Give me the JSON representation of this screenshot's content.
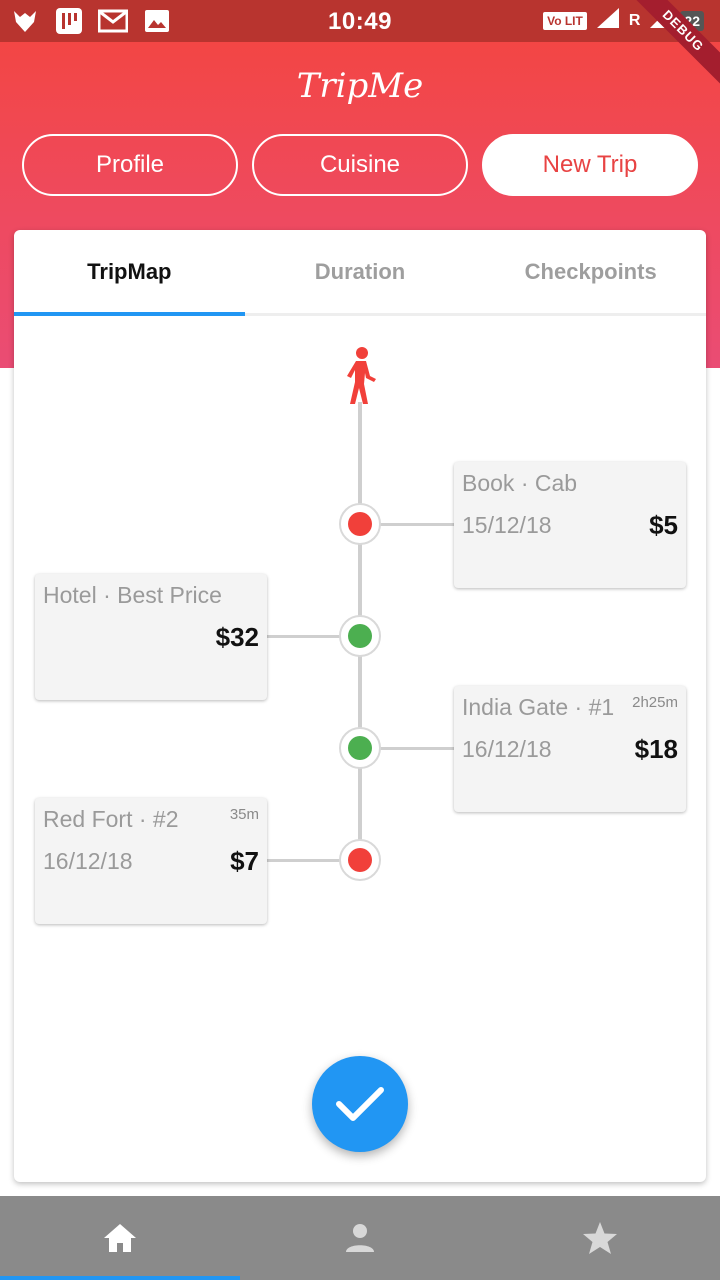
{
  "status_bar": {
    "time": "10:49",
    "volte": "Vo LIT",
    "carrier1": "R",
    "lte": "LTE",
    "carrier2": "R",
    "battery": "22",
    "debug_label": "DEBUG"
  },
  "app": {
    "title": "TripMe",
    "header_color": "#f4453e"
  },
  "nav_pills": [
    {
      "label": "Profile",
      "active": false
    },
    {
      "label": "Cuisine",
      "active": false
    },
    {
      "label": "New Trip",
      "active": true
    }
  ],
  "tabs": [
    {
      "label": "TripMap",
      "active": true
    },
    {
      "label": "Duration",
      "active": false
    },
    {
      "label": "Checkpoints",
      "active": false
    }
  ],
  "timeline": {
    "items": [
      {
        "title": "Book · Cab",
        "duration": "",
        "date": "15/12/18",
        "price": "$5",
        "status": "red"
      },
      {
        "title": "Hotel · Best Price",
        "duration": "",
        "date": "",
        "price": "$32",
        "status": "green"
      },
      {
        "title": "India Gate · #1",
        "duration": "2h25m",
        "date": "16/12/18",
        "price": "$18",
        "status": "green"
      },
      {
        "title": "Red Fort · #2",
        "duration": "35m",
        "date": "16/12/18",
        "price": "$7",
        "status": "red"
      }
    ]
  },
  "icons": {
    "walker": "walking-person-icon",
    "fab": "check-icon",
    "bottom_nav": [
      "home-icon",
      "person-icon",
      "star-icon"
    ]
  },
  "colors": {
    "accent": "#2196f3",
    "red": "#f1403a",
    "green": "#4caf50"
  }
}
